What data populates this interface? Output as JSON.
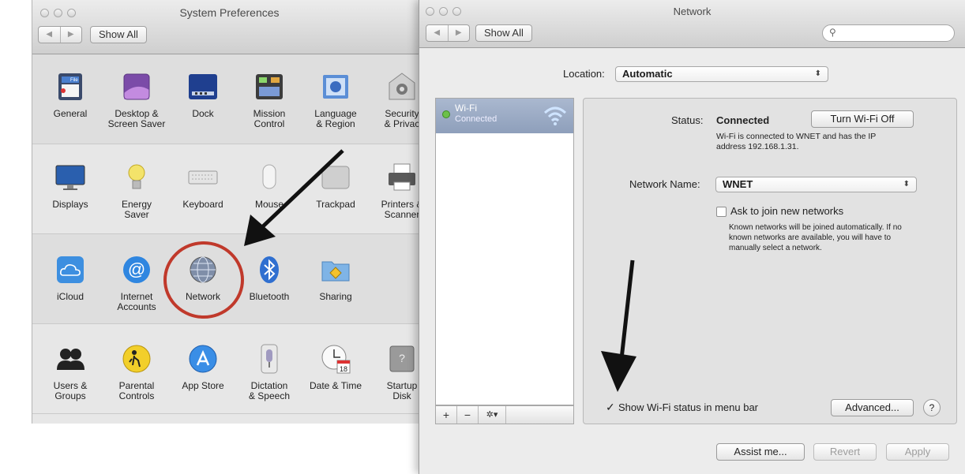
{
  "sysprefs": {
    "title": "System Preferences",
    "show_all": "Show All",
    "rows": [
      [
        {
          "label": "General",
          "icon": "general-icon"
        },
        {
          "label": "Desktop &\nScreen Saver",
          "icon": "desktop-icon"
        },
        {
          "label": "Dock",
          "icon": "dock-icon"
        },
        {
          "label": "Mission\nControl",
          "icon": "mission-control-icon"
        },
        {
          "label": "Language\n& Region",
          "icon": "language-icon"
        },
        {
          "label": "Security\n& Privac",
          "icon": "security-icon"
        }
      ],
      [
        {
          "label": "Displays",
          "icon": "displays-icon"
        },
        {
          "label": "Energy\nSaver",
          "icon": "energy-icon"
        },
        {
          "label": "Keyboard",
          "icon": "keyboard-icon"
        },
        {
          "label": "Mouse",
          "icon": "mouse-icon"
        },
        {
          "label": "Trackpad",
          "icon": "trackpad-icon"
        },
        {
          "label": "Printers &\nScanner",
          "icon": "printer-icon"
        }
      ],
      [
        {
          "label": "iCloud",
          "icon": "icloud-icon"
        },
        {
          "label": "Internet\nAccounts",
          "icon": "internet-accounts-icon"
        },
        {
          "label": "Network",
          "icon": "network-icon"
        },
        {
          "label": "Bluetooth",
          "icon": "bluetooth-icon"
        },
        {
          "label": "Sharing",
          "icon": "sharing-icon"
        }
      ],
      [
        {
          "label": "Users &\nGroups",
          "icon": "users-icon"
        },
        {
          "label": "Parental\nControls",
          "icon": "parental-icon"
        },
        {
          "label": "App Store",
          "icon": "app-store-icon"
        },
        {
          "label": "Dictation\n& Speech",
          "icon": "dictation-icon"
        },
        {
          "label": "Date & Time",
          "icon": "date-time-icon"
        },
        {
          "label": "Startup\nDisk",
          "icon": "startup-disk-icon"
        }
      ]
    ],
    "general_icon_text": "File New Ope",
    "calendar_day": "18"
  },
  "network": {
    "title": "Network",
    "show_all": "Show All",
    "location_label": "Location:",
    "location_value": "Automatic",
    "service_name": "Wi-Fi",
    "service_status": "Connected",
    "status_label": "Status:",
    "status_value": "Connected",
    "turn_off_button": "Turn Wi-Fi Off",
    "status_detail": "Wi-Fi is connected to WNET and has the IP address 192.168.1.31.",
    "network_name_label": "Network Name:",
    "network_name_value": "WNET",
    "ask_join_label": "Ask to join new networks",
    "ask_join_checked": false,
    "ask_join_detail": "Known networks will be joined automatically. If no known networks are available, you will have to manually select a network.",
    "show_status_label": "Show Wi-Fi status in menu bar",
    "show_status_checked": true,
    "advanced_button": "Advanced...",
    "help_button": "?",
    "assist_button": "Assist me...",
    "revert_button": "Revert",
    "apply_button": "Apply",
    "list_add": "+",
    "list_remove": "−",
    "list_action": "✲▾"
  },
  "colors": {
    "annotation_circle": "#c0392b",
    "arrow": "#111111",
    "selection": "#9aabc6",
    "status_dot": "#6cc04a"
  }
}
